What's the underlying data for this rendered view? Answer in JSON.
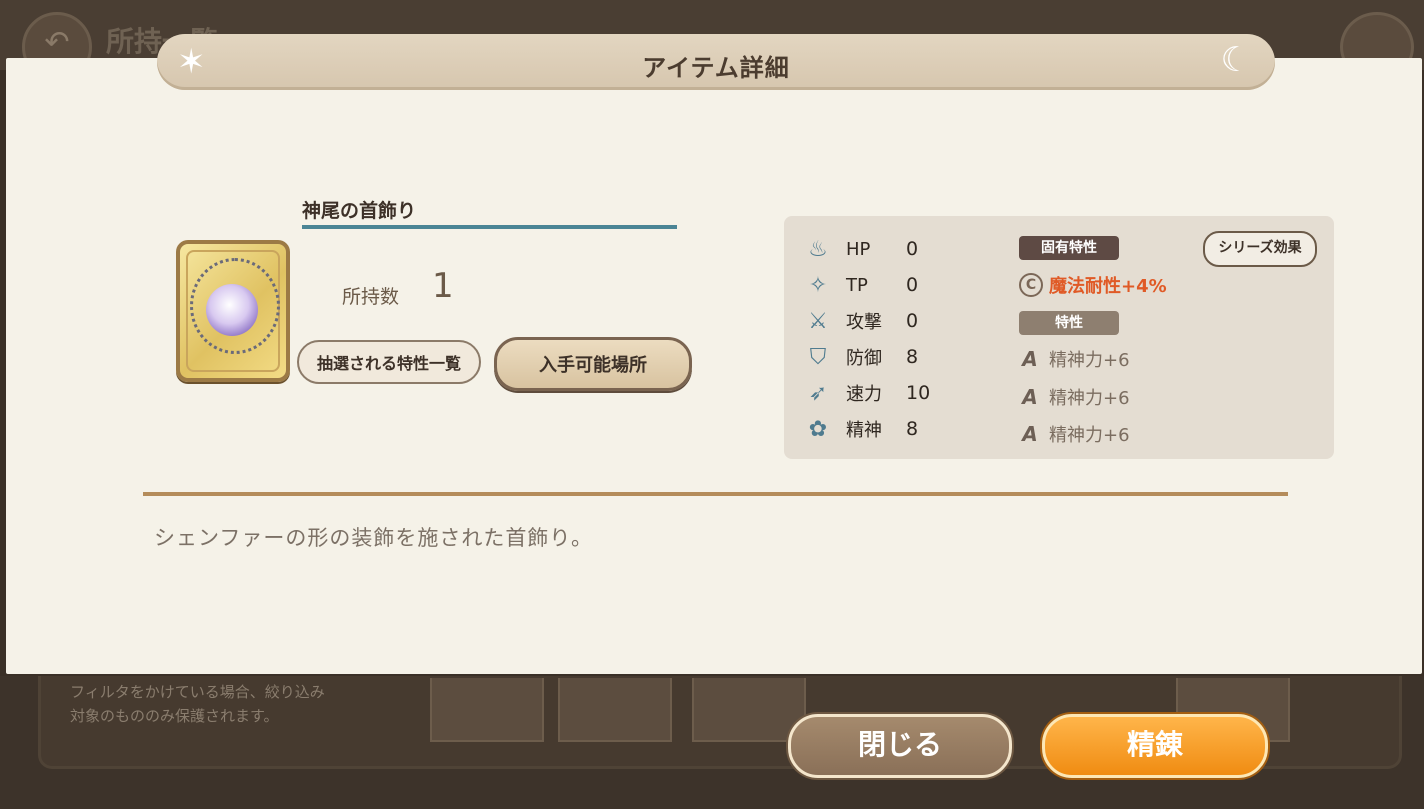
{
  "background": {
    "title": "所持一覧",
    "filter_note": "フィルタをかけている場合、絞り込み\n対象のもののみ保護されます。"
  },
  "modal": {
    "title": "アイテム詳細"
  },
  "item": {
    "name": "神尾の首飾り",
    "owned_label": "所持数",
    "owned_count": "1",
    "traits_list_button": "抽選される特性一覧",
    "sources_button": "入手可能場所",
    "description": "シェンファーの形の装飾を施された首飾り。"
  },
  "stats": [
    {
      "icon": "hp-icon",
      "label": "HP",
      "value": "0"
    },
    {
      "icon": "tp-icon",
      "label": "TP",
      "value": "0"
    },
    {
      "icon": "attack-icon",
      "label": "攻撃",
      "value": "0"
    },
    {
      "icon": "defense-icon",
      "label": "防御",
      "value": "8"
    },
    {
      "icon": "speed-icon",
      "label": "速力",
      "value": "10"
    },
    {
      "icon": "spirit-icon",
      "label": "精神",
      "value": "8"
    }
  ],
  "traits": {
    "unique_header": "固有特性",
    "series_button": "シリーズ効果",
    "unique_trait": {
      "rank": "C",
      "text": "魔法耐性+4%"
    },
    "normal_header": "特性",
    "normal_traits": [
      {
        "rank": "A",
        "text": "精神力+6"
      },
      {
        "rank": "A",
        "text": "精神力+6"
      },
      {
        "rank": "A",
        "text": "精神力+6"
      }
    ]
  },
  "buttons": {
    "close": "閉じる",
    "refine": "精錬"
  },
  "colors": {
    "accent_orange": "#f08c12",
    "unique_trait_text": "#e05a26",
    "underline_teal": "#4b8595"
  }
}
